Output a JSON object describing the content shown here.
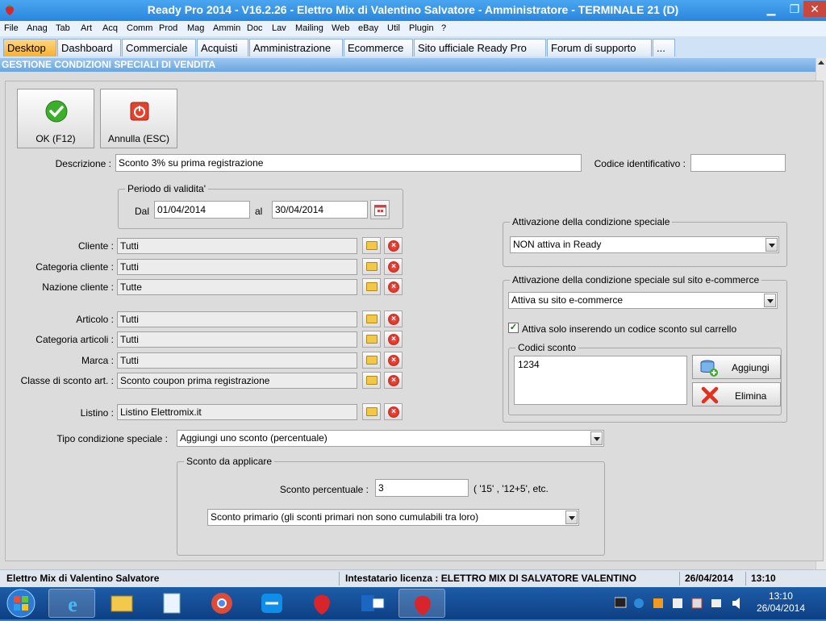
{
  "window": {
    "title": "Ready Pro 2014 - V16.2.26 - Elettro Mix di Valentino Salvatore - Amministratore - TERMINALE 21 (D)",
    "min_label": "▁",
    "max_label": "❐",
    "close_label": "✕"
  },
  "menu": [
    "File",
    "Anag",
    "Tab",
    "Art",
    "Acq",
    "Comm",
    "Prod",
    "Mag",
    "Ammin",
    "Doc",
    "Lav",
    "Mailing",
    "Web",
    "eBay",
    "Util",
    "Plugin",
    "?"
  ],
  "tabs": [
    "Desktop",
    "Dashboard",
    "Commerciale",
    "Acquisti",
    "Amministrazione",
    "Ecommerce",
    "Sito ufficiale Ready Pro",
    "Forum di supporto",
    "..."
  ],
  "section_title": "GESTIONE CONDIZIONI SPECIALI DI VENDITA",
  "buttons": {
    "ok": "OK (F12)",
    "cancel": "Annulla (ESC)"
  },
  "form": {
    "descrizione_label": "Descrizione :",
    "descrizione_value": "Sconto 3% su prima registrazione",
    "codice_label": "Codice identificativo :",
    "codice_value": "",
    "periodo_title": "Periodo di validita'",
    "dal_label": "Dal",
    "dal_value": "01/04/2014",
    "al_label": "al",
    "al_value": "30/04/2014",
    "cliente_label": "Cliente :",
    "cliente_value": "Tutti",
    "catcliente_label": "Categoria cliente :",
    "catcliente_value": "Tutti",
    "nazione_label": "Nazione cliente :",
    "nazione_value": "Tutte",
    "articolo_label": "Articolo :",
    "articolo_value": "Tutti",
    "catarticoli_label": "Categoria articoli :",
    "catarticoli_value": "Tutti",
    "marca_label": "Marca :",
    "marca_value": "Tutti",
    "classe_label": "Classe di sconto art. :",
    "classe_value": "Sconto coupon prima registrazione",
    "listino_label": "Listino :",
    "listino_value": "Listino Elettromix.it",
    "tipo_label": "Tipo condizione speciale :",
    "tipo_value": "Aggiungi uno sconto (percentuale)",
    "sconto_group": "Sconto da applicare",
    "sconto_perc_label": "Sconto percentuale :",
    "sconto_perc_value": "3",
    "sconto_hint": "( '15' ,  '12+5', etc.",
    "sconto_tipo_value": "Sconto primario (gli sconti primari non sono cumulabili tra loro)"
  },
  "activation": {
    "group_title": "Attivazione della condizione speciale",
    "value": "NON attiva in Ready",
    "web_group_title": "Attivazione della condizione speciale sul sito e-commerce",
    "web_value": "Attiva su sito e-commerce",
    "checkbox_label": "Attiva solo inserendo un codice sconto sul carrello",
    "checkbox_mark": "✓",
    "codici_title": "Codici sconto",
    "codici": [
      "1234"
    ],
    "add_label": "Aggiungi",
    "delete_label": "Elimina"
  },
  "statusbar": {
    "company": "Elettro Mix di Valentino Salvatore",
    "licence": "Intestatario licenza : ELETTRO MIX DI SALVATORE VALENTINO",
    "date": "26/04/2014",
    "time": "13:10"
  },
  "taskbar": {
    "clock_time": "13:10",
    "clock_date": "26/04/2014"
  },
  "colors": {
    "accent_tab": "#f6b030",
    "titlebar": "#2a86dc",
    "section_header": "#6aa6e0",
    "taskbar": "#0e3f82"
  }
}
